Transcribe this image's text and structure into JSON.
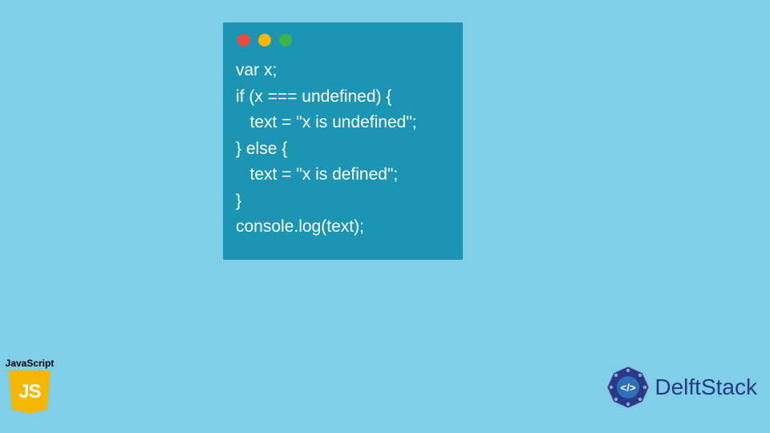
{
  "code_window": {
    "dots": [
      "red",
      "yellow",
      "green"
    ],
    "code": "var x;\nif (x === undefined) {\n   text = \"x is undefined\";\n} else {\n   text = \"x is defined\";\n}\nconsole.log(text);"
  },
  "js_badge": {
    "label": "JavaScript",
    "shield_text": "JS"
  },
  "brand": {
    "name": "DelftStack",
    "icon_glyph": "</>"
  },
  "colors": {
    "page_bg": "#7fcfe8",
    "window_bg": "#1c94b3",
    "code_text": "#ffffff",
    "dot_red": "#e94b3c",
    "dot_yellow": "#f5b700",
    "dot_green": "#3bb44a",
    "js_shield": "#f5b700",
    "brand_text": "#263b84"
  }
}
